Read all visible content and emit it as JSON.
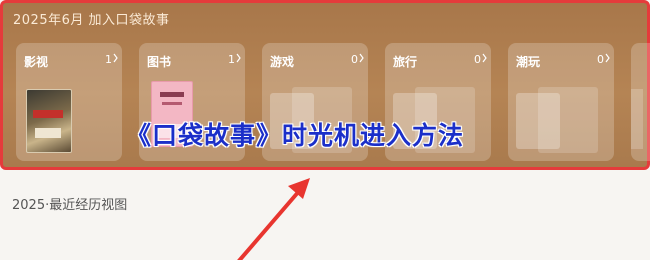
{
  "panel": {
    "title": "2025年6月 加入口袋故事",
    "cards": [
      {
        "name": "影视",
        "count": "1"
      },
      {
        "name": "图书",
        "count": "1"
      },
      {
        "name": "游戏",
        "count": "0"
      },
      {
        "name": "旅行",
        "count": "0"
      },
      {
        "name": "潮玩",
        "count": "0"
      }
    ]
  },
  "overlay": {
    "title": "《口袋故事》时光机进入方法"
  },
  "section": {
    "title": "2025·最近经历视图"
  },
  "colors": {
    "panel_brown": "#b58454",
    "highlight_red": "#e53b3b",
    "overlay_blue": "#1b2fc9"
  }
}
